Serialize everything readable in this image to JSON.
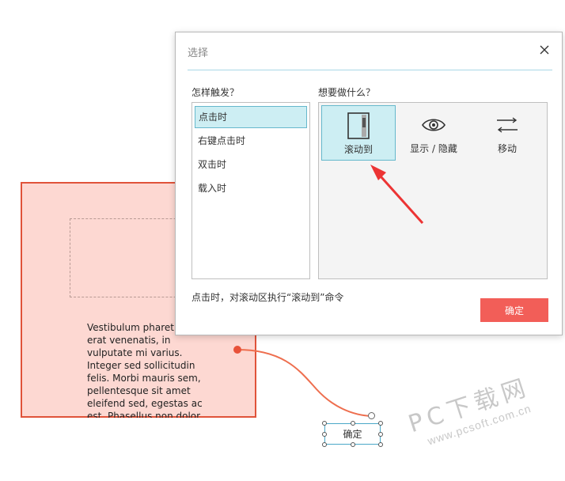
{
  "dialog": {
    "title": "选择",
    "trigger_label": "怎样触发？",
    "action_label": "想要做什么？",
    "triggers": [
      {
        "label": "点击时",
        "selected": true
      },
      {
        "label": "右键点击时",
        "selected": false
      },
      {
        "label": "双击时",
        "selected": false
      },
      {
        "label": "载入时",
        "selected": false
      }
    ],
    "actions": [
      {
        "label": "滚动到",
        "icon": "scroll-panel-icon",
        "selected": true
      },
      {
        "label": "显示 / 隐藏",
        "icon": "eye-icon",
        "selected": false
      },
      {
        "label": "移动",
        "icon": "move-arrows-icon",
        "selected": false
      }
    ],
    "status": "点击时，对滚动区执行“滚动到”命令",
    "ok_label": "确定"
  },
  "canvas": {
    "lorem_text": "Vestibulum pharetra ut erat venenatis, in vulputate mi varius. Integer sed sollicitudin felis. Morbi mauris sem, pellentesque sit amet eleifend sed, egestas ac est. Phasellus non dolor",
    "button_label": "确定"
  },
  "watermark": {
    "big": "PC下载网",
    "small": "www.pcsoft.com.cn"
  },
  "colors": {
    "accent": "#66b8cc",
    "selected_bg": "#cdeef3",
    "ok_button": "#f25e58",
    "panel_fill": "#fdd8d2",
    "panel_border": "#e0533a"
  }
}
